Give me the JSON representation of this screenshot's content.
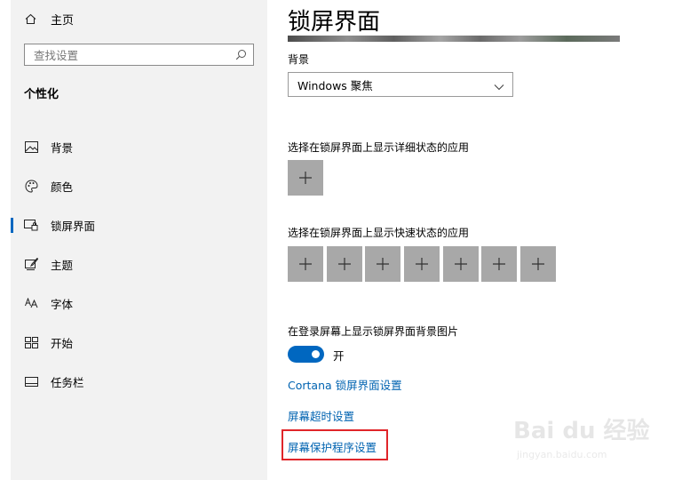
{
  "sidebar": {
    "home_label": "主页",
    "search_placeholder": "查找设置",
    "section_title": "个性化",
    "items": [
      {
        "label": "背景",
        "icon": "image-icon"
      },
      {
        "label": "颜色",
        "icon": "palette-icon"
      },
      {
        "label": "锁屏界面",
        "icon": "lock-screen-icon",
        "active": true
      },
      {
        "label": "主题",
        "icon": "theme-icon"
      },
      {
        "label": "字体",
        "icon": "font-icon"
      },
      {
        "label": "开始",
        "icon": "start-icon"
      },
      {
        "label": "任务栏",
        "icon": "taskbar-icon"
      }
    ]
  },
  "main": {
    "title": "锁屏界面",
    "background_label": "背景",
    "background_select_value": "Windows 聚焦",
    "detailed_status_label": "选择在锁屏界面上显示详细状态的应用",
    "quick_status_label": "选择在锁屏界面上显示快速状态的应用",
    "quick_status_slots": 7,
    "show_bg_on_signin_label": "在登录屏幕上显示锁屏界面背景图片",
    "toggle_state_text": "开",
    "toggle_on": true,
    "links": {
      "cortana": "Cortana 锁屏界面设置",
      "timeout": "屏幕超时设置",
      "screensaver": "屏幕保护程序设置"
    }
  },
  "colors": {
    "accent": "#0067c0",
    "link": "#0063b1",
    "sidebar_bg": "#f2f2f2",
    "tile": "#a8a8a8",
    "highlight": "#e0252a"
  },
  "watermark": {
    "brand": "Bai du 经验",
    "url": "jingyan.baidu.com"
  }
}
